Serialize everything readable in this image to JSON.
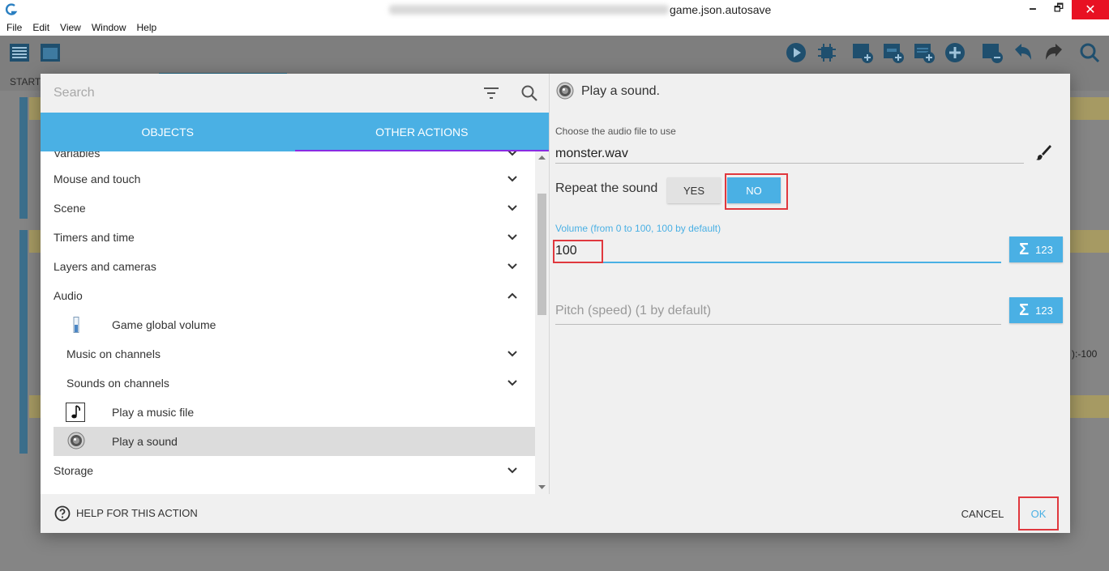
{
  "window": {
    "title": "game.json.autosave",
    "controls": {
      "minimize": "🗕",
      "maximize": "🗗",
      "close": "✕"
    }
  },
  "menubar": {
    "items": [
      "File",
      "Edit",
      "View",
      "Window",
      "Help"
    ]
  },
  "background": {
    "tab_start": "START",
    "right_text": "):-100"
  },
  "search": {
    "placeholder": "Search"
  },
  "tabs": {
    "objects": "OBJECTS",
    "other_actions": "OTHER ACTIONS"
  },
  "list": {
    "variables": "Variables",
    "mouse_touch": "Mouse and touch",
    "scene": "Scene",
    "timers": "Timers and time",
    "layers": "Layers and cameras",
    "audio": "Audio",
    "global_volume": "Game global volume",
    "music_channels": "Music on channels",
    "sounds_channels": "Sounds on channels",
    "play_music": "Play a music file",
    "play_sound": "Play a sound",
    "storage": "Storage"
  },
  "action": {
    "title": "Play a sound.",
    "audio_label": "Choose the audio file to use",
    "audio_value": "monster.wav",
    "repeat_label": "Repeat the sound",
    "yes": "YES",
    "no": "NO",
    "volume_label": "Volume (from 0 to 100, 100 by default)",
    "volume_value": "100",
    "expr_number": "123",
    "pitch_placeholder": "Pitch (speed) (1 by default)"
  },
  "footer": {
    "help": "HELP FOR THIS ACTION",
    "cancel": "CANCEL",
    "ok": "OK"
  },
  "colors": {
    "accent": "#4ab0e4",
    "highlight": "#e0383e",
    "tab_underline": "#8a2be2"
  }
}
